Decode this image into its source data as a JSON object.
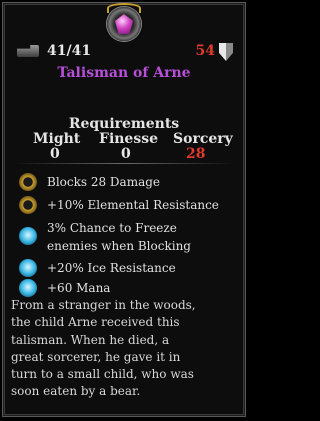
{
  "item": {
    "durability": "41/41",
    "value": "54",
    "name": "Talisman of Arne"
  },
  "requirements": {
    "title": "Requirements",
    "stats": [
      {
        "label": "Might",
        "value": "0",
        "color": "#e8e8e8"
      },
      {
        "label": "Finesse",
        "value": "0",
        "color": "#e8e8e8"
      },
      {
        "label": "Sorcery",
        "value": "28",
        "color": "#e03a2a"
      }
    ]
  },
  "properties": [
    {
      "icon": "gold-ring-icon",
      "text": "Blocks 28 Damage"
    },
    {
      "icon": "gold-ring-icon",
      "text": "+10% Elemental Resistance"
    },
    {
      "icon": "ice-orb-icon",
      "text": "3% Chance to Freeze"
    },
    {
      "icon": "",
      "text": "enemies when Blocking"
    },
    {
      "icon": "ice-orb-icon",
      "text": "+20% Ice Resistance"
    },
    {
      "icon": "ice-orb-icon",
      "text": "+60 Mana"
    }
  ],
  "description": {
    "lines": [
      "From a stranger in the woods,",
      "the child Arne received this",
      "talisman. When he died, a",
      "great sorcerer, he gave it in",
      "turn to a small child, who was",
      "soon eaten by a bear."
    ]
  }
}
